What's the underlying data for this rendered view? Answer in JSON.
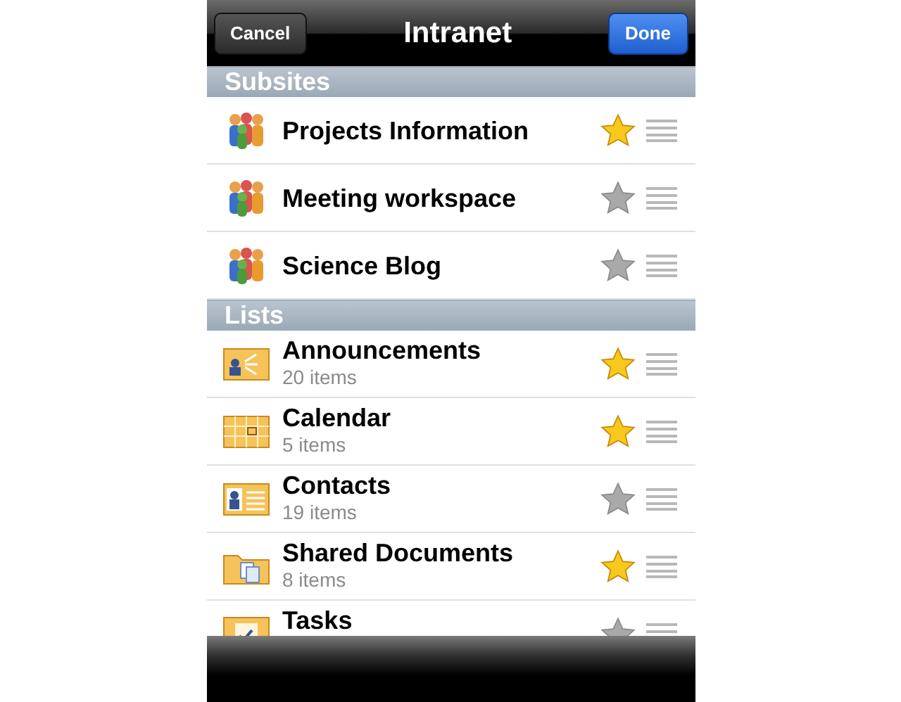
{
  "nav_bar": {
    "cancel": "Cancel",
    "title": "Intranet",
    "done": "Done"
  },
  "sections": [
    {
      "header": "Subsites",
      "items": [
        {
          "kind": "site",
          "title": "Projects Information",
          "starred": true
        },
        {
          "kind": "site",
          "title": "Meeting workspace",
          "starred": false
        },
        {
          "kind": "site",
          "title": "Science Blog",
          "starred": false
        }
      ]
    },
    {
      "header": "Lists",
      "items": [
        {
          "kind": "announcements",
          "title": "Announcements",
          "subtitle": "20 items",
          "starred": true
        },
        {
          "kind": "calendar",
          "title": "Calendar",
          "subtitle": "5 items",
          "starred": true
        },
        {
          "kind": "contacts",
          "title": "Contacts",
          "subtitle": "19 items",
          "starred": false
        },
        {
          "kind": "documents",
          "title": "Shared Documents",
          "subtitle": "8 items",
          "starred": true
        },
        {
          "kind": "tasks",
          "title": "Tasks",
          "starred": false
        }
      ]
    }
  ]
}
